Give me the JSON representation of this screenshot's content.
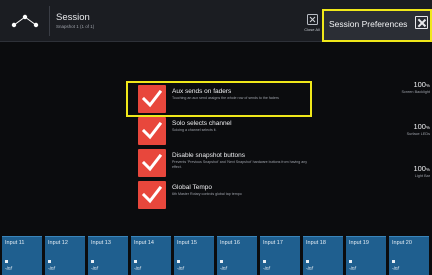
{
  "header": {
    "title": "Session",
    "subtitle": "Snapshot 1 (1 of 1)",
    "close_all_label": "Close All"
  },
  "preferences_panel": {
    "title": "Session Preferences"
  },
  "options": [
    {
      "label": "Aux sends on faders",
      "description": "Touching an aux send assigns the whole row of sends to the faders",
      "checked": true
    },
    {
      "label": "Solo selects channel",
      "description": "Soloing a channel selects it.",
      "checked": true
    },
    {
      "label": "Disable snapshot buttons",
      "description": "Prevents 'Previous Snapshot' and 'Next Snapshot' hardware buttons from having any effect.",
      "checked": true
    },
    {
      "label": "Global Tempo",
      "description": "6th Master Rotary controls global tap tempo",
      "checked": true
    }
  ],
  "meters": [
    {
      "value": "100",
      "unit": "%",
      "label": "Screen Backlight"
    },
    {
      "value": "100",
      "unit": "%",
      "label": "Surface LEDs"
    },
    {
      "value": "100",
      "unit": "%",
      "label": "Light Bar"
    }
  ],
  "channels": [
    {
      "name": "Input 11",
      "value": "-inf"
    },
    {
      "name": "Input 12",
      "value": "-inf"
    },
    {
      "name": "Input 13",
      "value": "-inf"
    },
    {
      "name": "Input 14",
      "value": "-inf"
    },
    {
      "name": "Input 15",
      "value": "-inf"
    },
    {
      "name": "Input 16",
      "value": "-inf"
    },
    {
      "name": "Input 17",
      "value": "-inf"
    },
    {
      "name": "Input 18",
      "value": "-inf"
    },
    {
      "name": "Input 19",
      "value": "-inf"
    },
    {
      "name": "Input 20",
      "value": "-inf"
    }
  ],
  "colors": {
    "accent_check": "#e8473c",
    "highlight": "#f0e81a",
    "channel_bg": "#1f5f8f"
  }
}
